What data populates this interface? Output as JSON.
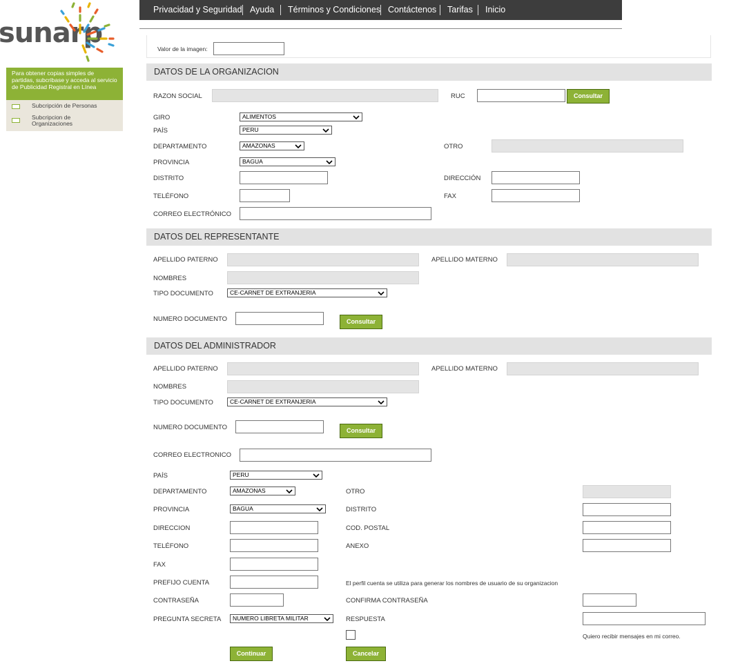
{
  "logo": {
    "text": "sunarp"
  },
  "sidebar": {
    "promo": "Para obtener copias simples de partidas, subcribase y acceda al servicio de Publicidad Registral en Línea",
    "items": [
      {
        "label": "Subcripción de Personas"
      },
      {
        "label": "Subcripcion de Organizaciones"
      }
    ]
  },
  "nav": {
    "items": [
      {
        "label": "Privacidad y Seguridad"
      },
      {
        "label": "Ayuda"
      },
      {
        "label": "Términos y Condiciones"
      },
      {
        "label": "Contáctenos"
      },
      {
        "label": "Tarifas"
      },
      {
        "label": "Inicio"
      }
    ]
  },
  "captcha": {
    "label": "Valor de la imagen:",
    "value": ""
  },
  "org": {
    "title": "DATOS DE LA ORGANIZACION",
    "razon_social": "RAZON SOCIAL",
    "ruc": "RUC",
    "consultar": "Consultar",
    "giro": "GIRO",
    "giro_value": "ALIMENTOS",
    "pais": "PAÍS",
    "pais_value": "PERU",
    "departamento": "DEPARTAMENTO",
    "departamento_value": "AMAZONAS",
    "otro": "OTRO",
    "provincia": "PROVINCIA",
    "provincia_value": "BAGUA",
    "distrito": "DISTRITO",
    "direccion": "DIRECCIÓN",
    "telefono": "TELÉFONO",
    "fax": "FAX",
    "correo": "CORREO ELECTRÓNICO"
  },
  "rep": {
    "title": "DATOS DEL REPRESENTANTE",
    "ap_paterno": "APELLIDO PATERNO",
    "ap_materno": "APELLIDO MATERNO",
    "nombres": "NOMBRES",
    "tipo_doc": "TIPO DOCUMENTO",
    "tipo_doc_value": "CE-CARNET DE EXTRANJERIA",
    "num_doc": "NUMERO DOCUMENTO",
    "consultar": "Consultar"
  },
  "adm": {
    "title": "DATOS DEL ADMINISTRADOR",
    "ap_paterno": "APELLIDO PATERNO",
    "ap_materno": "APELLIDO MATERNO",
    "nombres": "NOMBRES",
    "tipo_doc": "TIPO DOCUMENTO",
    "tipo_doc_value": "CE-CARNET DE EXTRANJERIA",
    "num_doc": "NUMERO DOCUMENTO",
    "consultar": "Consultar",
    "correo": "CORREO ELECTRONICO",
    "pais": "PAÍS",
    "pais_value": "PERU",
    "departamento": "DEPARTAMENTO",
    "departamento_value": "AMAZONAS",
    "otro": "OTRO",
    "provincia": "PROVINCIA",
    "provincia_value": "BAGUA",
    "distrito": "DISTRITO",
    "direccion": "DIRECCION",
    "cod_postal": "COD. POSTAL",
    "telefono": "TELÉFONO",
    "anexo": "ANEXO",
    "fax": "FAX",
    "prefijo": "PREFIJO CUENTA",
    "prefijo_note": "El perfil cuenta se utiliza para generar los nombres de usuario de su organizacion",
    "contrasena": "CONTRASEÑA",
    "confirma": "CONFIRMA CONTRASEÑA",
    "pregunta": "PREGUNTA SECRETA",
    "pregunta_value": "NUMERO LIBRETA MILITAR",
    "respuesta": "RESPUESTA",
    "mensajes": "Quiero recibir mensajes en mi correo."
  },
  "actions": {
    "continuar": "Continuar",
    "cancelar": "Cancelar"
  },
  "colors": {
    "accent": "#8db236",
    "nav_bg": "#3d3d3d",
    "section_bg": "#e2e2e2"
  }
}
